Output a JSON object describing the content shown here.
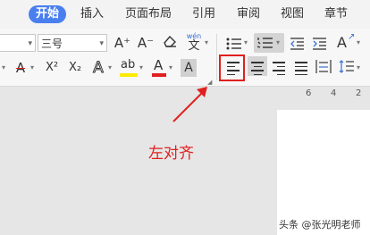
{
  "tabs": [
    {
      "label": "开始",
      "active": true
    },
    {
      "label": "插入"
    },
    {
      "label": "页面布局"
    },
    {
      "label": "引用"
    },
    {
      "label": "审阅"
    },
    {
      "label": "视图"
    },
    {
      "label": "章节"
    }
  ],
  "font": {
    "size_value": "三号"
  },
  "icons": {
    "grow_font": "A⁺",
    "shrink_font": "A⁻",
    "clear_format": "eraser",
    "phonetic_top": "wén",
    "phonetic_bottom": "文",
    "strikethrough": "A",
    "superscript": "X²",
    "subscript": "X₂",
    "text_effect": "A",
    "highlight": "ab",
    "font_color": "A",
    "char_shading": "A"
  },
  "colors": {
    "accent": "#4a7ff0",
    "annotation": "#e0201e",
    "highlight": "#ffeb00",
    "font_color": "#e0201e"
  },
  "ruler": {
    "ticks": [
      "6",
      "4",
      "2"
    ]
  },
  "annotation": {
    "text": "左对齐"
  },
  "watermark": {
    "text": "头条 @张光明老师"
  }
}
